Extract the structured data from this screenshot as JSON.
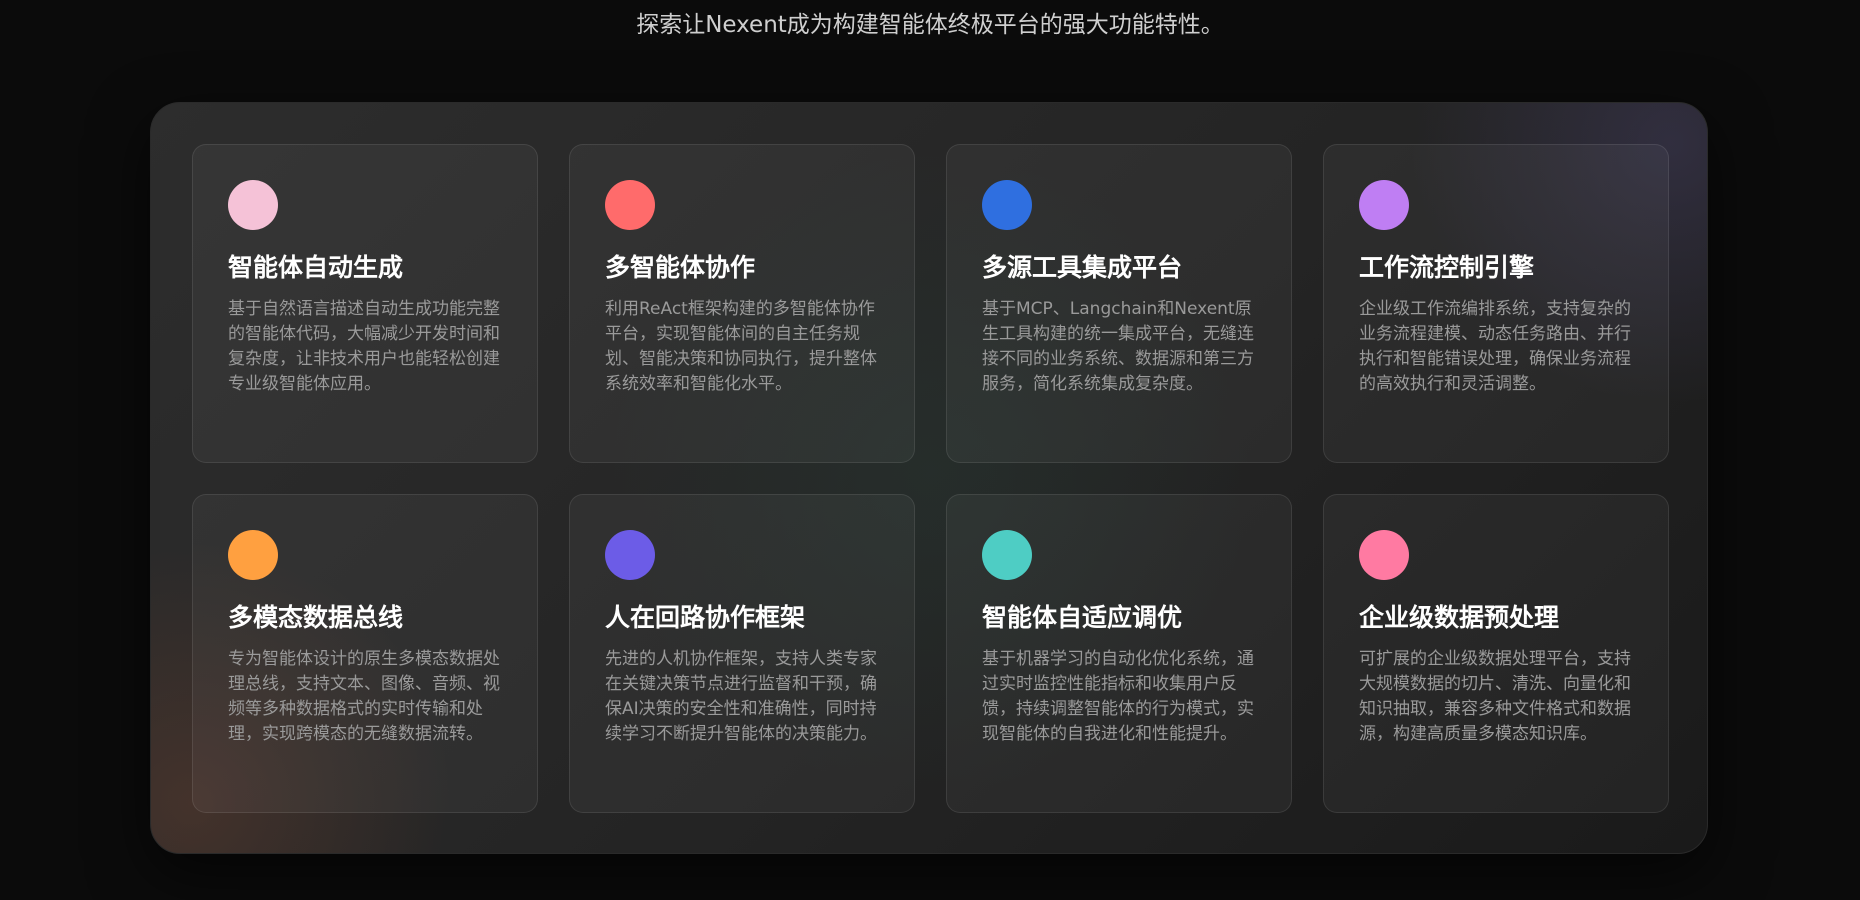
{
  "header": {
    "subtitle": "探索让Nexent成为构建智能体终极平台的强大功能特性。"
  },
  "features": [
    {
      "title": "智能体自动生成",
      "description": "基于自然语言描述自动生成功能完整的智能体代码，大幅减少开发时间和复杂度，让非技术用户也能轻松创建专业级智能体应用。",
      "color": "#f5c2d7"
    },
    {
      "title": "多智能体协作",
      "description": "利用ReAct框架构建的多智能体协作平台，实现智能体间的自主任务规划、智能决策和协同执行，提升整体系统效率和智能化水平。",
      "color": "#ff6b6b"
    },
    {
      "title": "多源工具集成平台",
      "description": "基于MCP、Langchain和Nexent原生工具构建的统一集成平台，无缝连接不同的业务系统、数据源和第三方服务，简化系统集成复杂度。",
      "color": "#2f6fe0"
    },
    {
      "title": "工作流控制引擎",
      "description": "企业级工作流编排系统，支持复杂的业务流程建模、动态任务路由、并行执行和智能错误处理，确保业务流程的高效执行和灵活调整。",
      "color": "#bf7ef3"
    },
    {
      "title": "多模态数据总线",
      "description": "专为智能体设计的原生多模态数据处理总线，支持文本、图像、音频、视频等多种数据格式的实时传输和处理，实现跨模态的无缝数据流转。",
      "color": "#ffa040"
    },
    {
      "title": "人在回路协作框架",
      "description": "先进的人机协作框架，支持人类专家在关键决策节点进行监督和干预，确保AI决策的安全性和准确性，同时持续学习不断提升智能体的决策能力。",
      "color": "#6c5ce7"
    },
    {
      "title": "智能体自适应调优",
      "description": "基于机器学习的自动化优化系统，通过实时监控性能指标和收集用户反馈，持续调整智能体的行为模式，实现智能体的自我进化和性能提升。",
      "color": "#4ecdc4"
    },
    {
      "title": "企业级数据预处理",
      "description": "可扩展的企业级数据处理平台，支持大规模数据的切片、清洗、向量化和知识抽取，兼容多种文件格式和数据源，构建高质量多模态知识库。",
      "color": "#ff7aa2"
    }
  ]
}
